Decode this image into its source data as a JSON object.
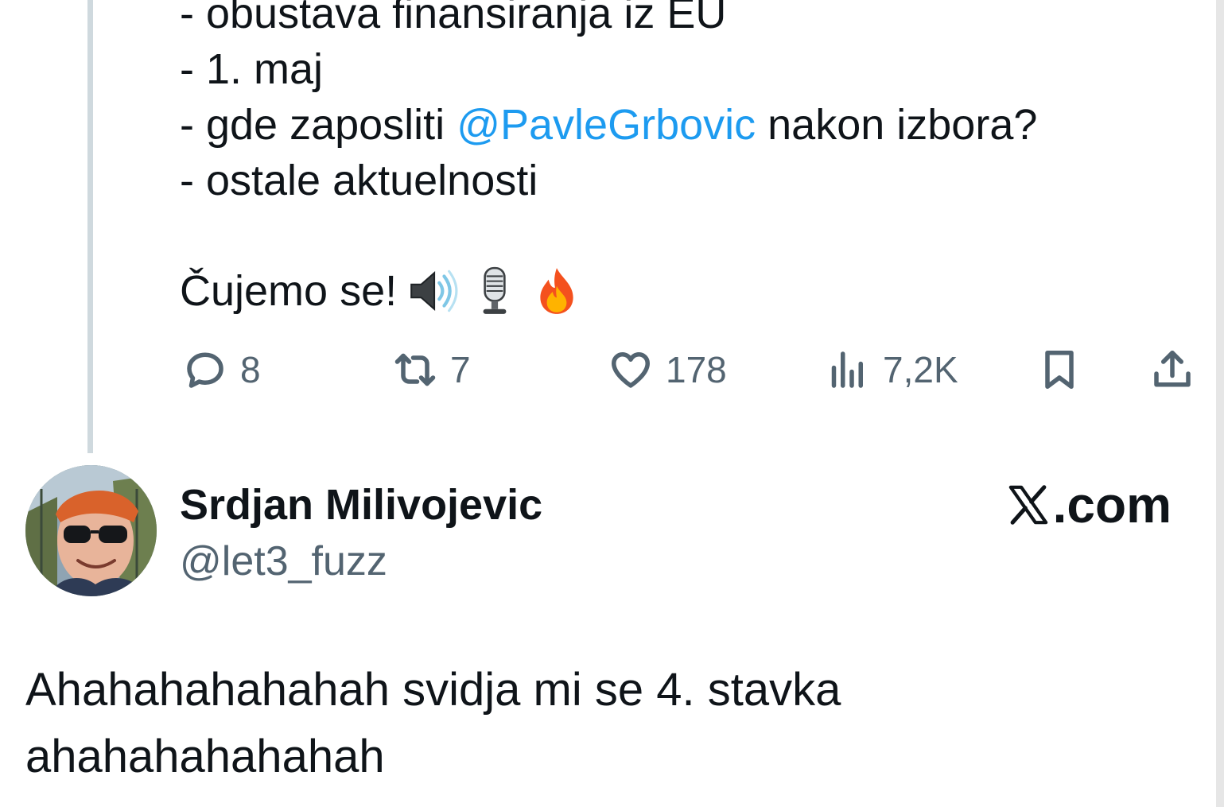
{
  "quoted_tweet": {
    "lines": [
      "- obustava finansiranja iz EU",
      "- 1. maj",
      "- gde zaposliti ",
      "- ostale aktuelnosti"
    ],
    "mention": "@PavleGrbovic",
    "mention_suffix": " nakon izbora?",
    "closing": "Čujemo se!",
    "emojis": [
      "speaker-icon",
      "microphone-icon",
      "fire-icon"
    ]
  },
  "actions": {
    "reply_count": "8",
    "retweet_count": "7",
    "like_count": "178",
    "views_count": "7,2K"
  },
  "reply_tweet": {
    "author_name": "Srdjan Milivojevic",
    "author_handle": "@let3_fuzz",
    "text": "Ahahahahahahah svidja mi se 4. stavka ahahahahahahah"
  },
  "brand": {
    "label": ".com"
  },
  "colors": {
    "text": "#0f1419",
    "secondary": "#536471",
    "mention": "#1d9bf0",
    "thread_line": "#cfd9de"
  }
}
